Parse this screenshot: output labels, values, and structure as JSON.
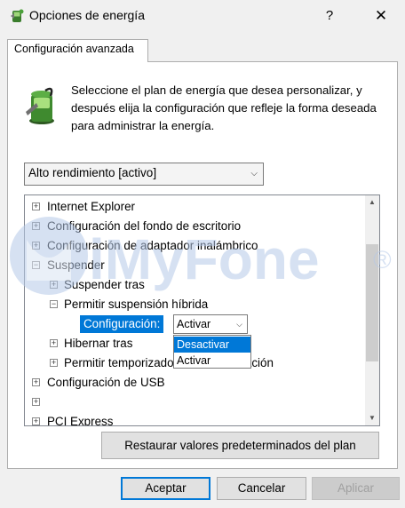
{
  "window": {
    "title": "Opciones de energía",
    "help": "?",
    "close": "✕"
  },
  "tab": {
    "label": "Configuración avanzada"
  },
  "description": "Seleccione el plan de energía que desea personalizar, y después elija la configuración que refleje la forma deseada para administrar la energía.",
  "plan_select": {
    "value": "Alto rendimiento [activo]"
  },
  "tree": {
    "items": [
      {
        "label": "Internet Explorer",
        "toggle": "+"
      },
      {
        "label": "Configuración del fondo de escritorio",
        "toggle": "+"
      },
      {
        "label": "Configuración de adaptador inalámbrico",
        "toggle": "+"
      },
      {
        "label": "Suspender",
        "toggle": "−"
      },
      {
        "label": "Suspender tras",
        "toggle": "+"
      },
      {
        "label": "Permitir suspensión híbrida",
        "toggle": "−"
      },
      {
        "label": "Hibernar tras",
        "toggle": "+"
      },
      {
        "label": "Permitir temporizadores de reactivación",
        "toggle": "+"
      },
      {
        "label": "Configuración de USB",
        "toggle": "+"
      },
      {
        "label": "",
        "toggle": "+"
      },
      {
        "label": "PCI Express",
        "toggle": "+"
      }
    ],
    "setting": {
      "label": "Configuración:",
      "value": "Activar",
      "options": [
        "Desactivar",
        "Activar"
      ],
      "highlighted": "Desactivar"
    }
  },
  "watermark": {
    "text": "iMyFone",
    "mark": "®"
  },
  "buttons": {
    "restore": "Restaurar valores predeterminados del plan",
    "ok": "Aceptar",
    "cancel": "Cancelar",
    "apply": "Aplicar"
  },
  "colors": {
    "accent": "#0078d7",
    "watermark": "#b5c9e8"
  }
}
